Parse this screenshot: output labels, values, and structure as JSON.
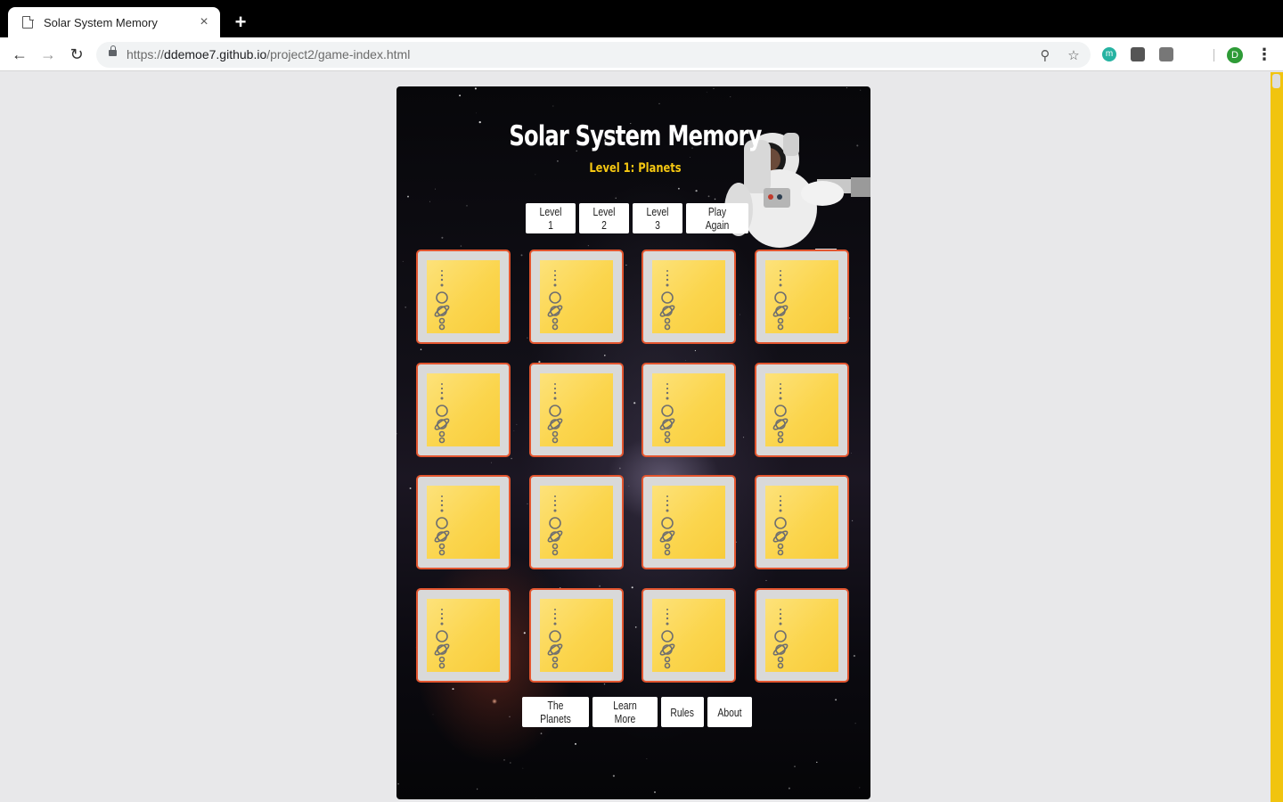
{
  "browser": {
    "tab_title": "Solar System Memory",
    "tab_close": "×",
    "new_tab": "+",
    "url_scheme": "https://",
    "url_host": "ddemoe7.github.io",
    "url_path": "/project2/game-index.html",
    "profile_initial": "D",
    "extension_m_label": "m"
  },
  "game": {
    "title": "Solar System Memory",
    "subtitle": "Level 1: Planets",
    "level_buttons": [
      "Level 1",
      "Level 2",
      "Level 3",
      "Play Again"
    ],
    "footer_buttons": [
      "The Planets",
      "Learn More",
      "Rules",
      "About"
    ],
    "card_count": 16,
    "card_face": "solar-system-icon",
    "colors": {
      "title": "#ffffff",
      "subtitle": "#f6c811",
      "card_border": "#e2552f",
      "card_back": "#fbd54d",
      "scrollbar": "#f1c40f"
    }
  }
}
